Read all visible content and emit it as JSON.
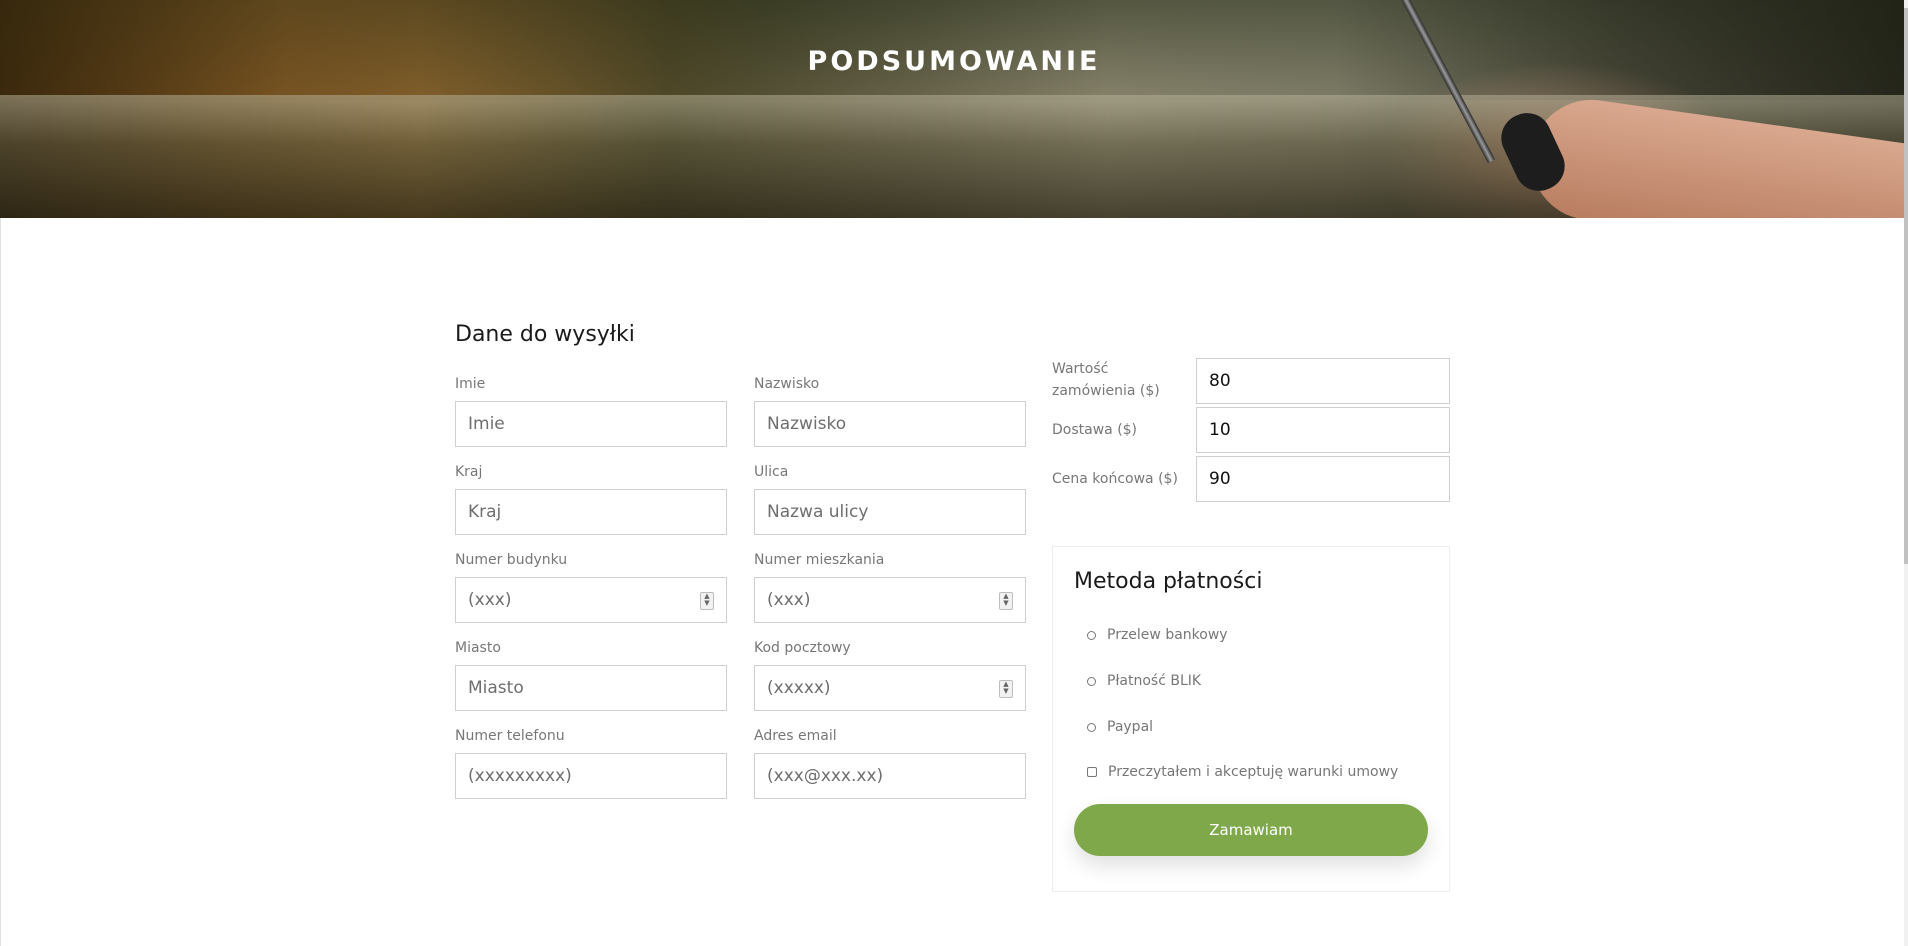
{
  "hero": {
    "title": "PODSUMOWANIE"
  },
  "shipping": {
    "title": "Dane do wysyłki",
    "fields": [
      {
        "label": "Imie",
        "placeholder": "Imie",
        "spinner": false
      },
      {
        "label": "Nazwisko",
        "placeholder": "Nazwisko",
        "spinner": false
      },
      {
        "label": "Kraj",
        "placeholder": "Kraj",
        "spinner": false
      },
      {
        "label": "Ulica",
        "placeholder": "Nazwa ulicy",
        "spinner": false
      },
      {
        "label": "Numer budynku",
        "placeholder": "(xxx)",
        "spinner": true
      },
      {
        "label": "Numer mieszkania",
        "placeholder": "(xxx)",
        "spinner": true
      },
      {
        "label": "Miasto",
        "placeholder": "Miasto",
        "spinner": false
      },
      {
        "label": "Kod pocztowy",
        "placeholder": "(xxxxx)",
        "spinner": true
      },
      {
        "label": "Numer telefonu",
        "placeholder": "(xxxxxxxxx)",
        "spinner": false
      },
      {
        "label": "Adres email",
        "placeholder": "(xxx@xxx.xx)",
        "spinner": false
      }
    ]
  },
  "summary": {
    "order_value": {
      "label": "Wartość zamówienia ($)",
      "value": "80"
    },
    "delivery": {
      "label": "Dostawa ($)",
      "value": "10"
    },
    "final_price": {
      "label": "Cena końcowa ($)",
      "value": "90"
    }
  },
  "payment": {
    "title": "Metoda płatności",
    "options": [
      {
        "label": "Przelew bankowy"
      },
      {
        "label": "Płatność BLIK"
      },
      {
        "label": "Paypal"
      }
    ],
    "terms_label": "Przeczytałem i akceptuję warunki umowy",
    "order_button": "Zamawiam"
  },
  "colors": {
    "accent": "#7fa84a",
    "border": "#cfcfcf"
  }
}
